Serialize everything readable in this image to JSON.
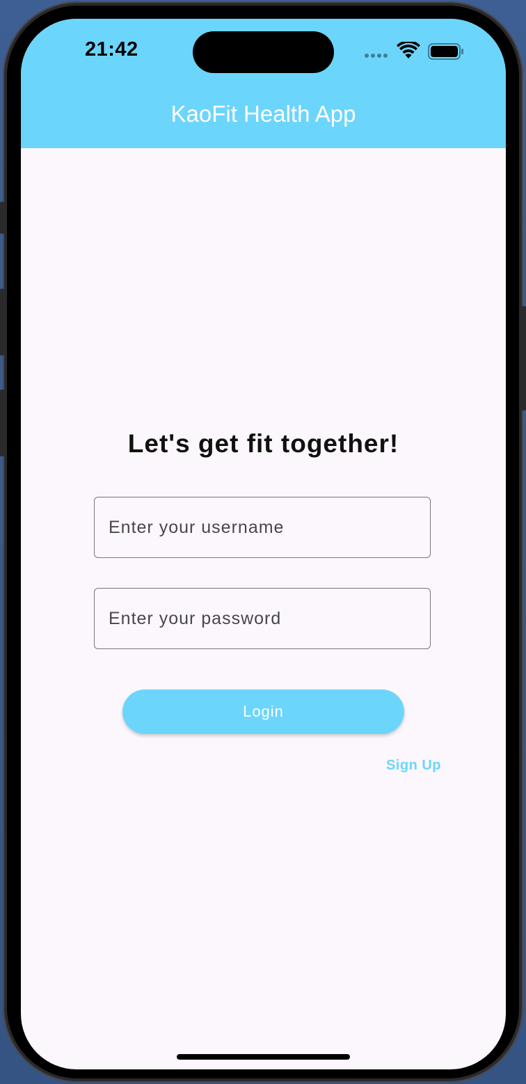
{
  "status_bar": {
    "time": "21:42"
  },
  "app_bar": {
    "title": "KaoFit Health App"
  },
  "login": {
    "headline": "Let's get fit together!",
    "username_placeholder": "Enter your username",
    "password_placeholder": "Enter your password",
    "login_label": "Login",
    "signup_label": "Sign Up"
  },
  "icons": {
    "signal": "cellular-signal-icon",
    "wifi": "wifi-icon",
    "battery": "battery-icon"
  },
  "colors": {
    "accent": "#6cd5fc",
    "background": "#fcf7fc",
    "text": "#111111",
    "field_border": "#79747e"
  }
}
